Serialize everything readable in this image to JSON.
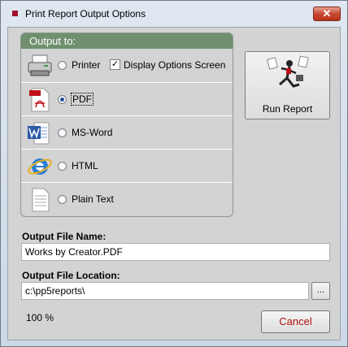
{
  "window": {
    "title": "Print Report Output Options",
    "close_glyph": "✕"
  },
  "output_group": {
    "header": "Output to:",
    "options": [
      {
        "label": "Printer",
        "icon": "printer-icon",
        "selected": false
      },
      {
        "label": "PDF",
        "icon": "pdf-icon",
        "selected": true
      },
      {
        "label": "MS-Word",
        "icon": "word-icon",
        "selected": false
      },
      {
        "label": "HTML",
        "icon": "internet-explorer-icon",
        "selected": false
      },
      {
        "label": "Plain Text",
        "icon": "text-file-icon",
        "selected": false
      }
    ],
    "display_options": {
      "label": "Display Options Screen",
      "checked": true,
      "check_glyph": "✓"
    }
  },
  "run_report": {
    "label": "Run Report",
    "icon": "running-man-icon"
  },
  "output_file_name": {
    "label": "Output File Name:",
    "value": "Works by Creator.PDF"
  },
  "output_file_location": {
    "label": "Output File Location:",
    "value": "c:\\pp5reports\\",
    "browse_label": "..."
  },
  "progress": "100 %",
  "cancel_label": "Cancel",
  "colors": {
    "group_header": "#6f8f6f",
    "cancel_text": "#b01010",
    "close_button": "#c84a32"
  }
}
